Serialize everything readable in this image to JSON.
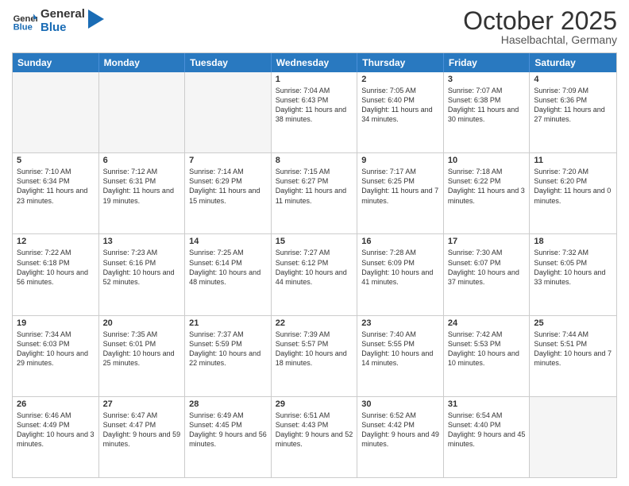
{
  "header": {
    "logo_line1": "General",
    "logo_line2": "Blue",
    "month": "October 2025",
    "location": "Haselbachtal, Germany"
  },
  "days_of_week": [
    "Sunday",
    "Monday",
    "Tuesday",
    "Wednesday",
    "Thursday",
    "Friday",
    "Saturday"
  ],
  "weeks": [
    [
      {
        "day": "",
        "empty": true
      },
      {
        "day": "",
        "empty": true
      },
      {
        "day": "",
        "empty": true
      },
      {
        "day": "1",
        "rise": "7:04 AM",
        "set": "6:43 PM",
        "daylight": "11 hours and 38 minutes."
      },
      {
        "day": "2",
        "rise": "7:05 AM",
        "set": "6:40 PM",
        "daylight": "11 hours and 34 minutes."
      },
      {
        "day": "3",
        "rise": "7:07 AM",
        "set": "6:38 PM",
        "daylight": "11 hours and 30 minutes."
      },
      {
        "day": "4",
        "rise": "7:09 AM",
        "set": "6:36 PM",
        "daylight": "11 hours and 27 minutes."
      }
    ],
    [
      {
        "day": "5",
        "rise": "7:10 AM",
        "set": "6:34 PM",
        "daylight": "11 hours and 23 minutes."
      },
      {
        "day": "6",
        "rise": "7:12 AM",
        "set": "6:31 PM",
        "daylight": "11 hours and 19 minutes."
      },
      {
        "day": "7",
        "rise": "7:14 AM",
        "set": "6:29 PM",
        "daylight": "11 hours and 15 minutes."
      },
      {
        "day": "8",
        "rise": "7:15 AM",
        "set": "6:27 PM",
        "daylight": "11 hours and 11 minutes."
      },
      {
        "day": "9",
        "rise": "7:17 AM",
        "set": "6:25 PM",
        "daylight": "11 hours and 7 minutes."
      },
      {
        "day": "10",
        "rise": "7:18 AM",
        "set": "6:22 PM",
        "daylight": "11 hours and 3 minutes."
      },
      {
        "day": "11",
        "rise": "7:20 AM",
        "set": "6:20 PM",
        "daylight": "11 hours and 0 minutes."
      }
    ],
    [
      {
        "day": "12",
        "rise": "7:22 AM",
        "set": "6:18 PM",
        "daylight": "10 hours and 56 minutes."
      },
      {
        "day": "13",
        "rise": "7:23 AM",
        "set": "6:16 PM",
        "daylight": "10 hours and 52 minutes."
      },
      {
        "day": "14",
        "rise": "7:25 AM",
        "set": "6:14 PM",
        "daylight": "10 hours and 48 minutes."
      },
      {
        "day": "15",
        "rise": "7:27 AM",
        "set": "6:12 PM",
        "daylight": "10 hours and 44 minutes."
      },
      {
        "day": "16",
        "rise": "7:28 AM",
        "set": "6:09 PM",
        "daylight": "10 hours and 41 minutes."
      },
      {
        "day": "17",
        "rise": "7:30 AM",
        "set": "6:07 PM",
        "daylight": "10 hours and 37 minutes."
      },
      {
        "day": "18",
        "rise": "7:32 AM",
        "set": "6:05 PM",
        "daylight": "10 hours and 33 minutes."
      }
    ],
    [
      {
        "day": "19",
        "rise": "7:34 AM",
        "set": "6:03 PM",
        "daylight": "10 hours and 29 minutes."
      },
      {
        "day": "20",
        "rise": "7:35 AM",
        "set": "6:01 PM",
        "daylight": "10 hours and 25 minutes."
      },
      {
        "day": "21",
        "rise": "7:37 AM",
        "set": "5:59 PM",
        "daylight": "10 hours and 22 minutes."
      },
      {
        "day": "22",
        "rise": "7:39 AM",
        "set": "5:57 PM",
        "daylight": "10 hours and 18 minutes."
      },
      {
        "day": "23",
        "rise": "7:40 AM",
        "set": "5:55 PM",
        "daylight": "10 hours and 14 minutes."
      },
      {
        "day": "24",
        "rise": "7:42 AM",
        "set": "5:53 PM",
        "daylight": "10 hours and 10 minutes."
      },
      {
        "day": "25",
        "rise": "7:44 AM",
        "set": "5:51 PM",
        "daylight": "10 hours and 7 minutes."
      }
    ],
    [
      {
        "day": "26",
        "rise": "6:46 AM",
        "set": "4:49 PM",
        "daylight": "10 hours and 3 minutes."
      },
      {
        "day": "27",
        "rise": "6:47 AM",
        "set": "4:47 PM",
        "daylight": "9 hours and 59 minutes."
      },
      {
        "day": "28",
        "rise": "6:49 AM",
        "set": "4:45 PM",
        "daylight": "9 hours and 56 minutes."
      },
      {
        "day": "29",
        "rise": "6:51 AM",
        "set": "4:43 PM",
        "daylight": "9 hours and 52 minutes."
      },
      {
        "day": "30",
        "rise": "6:52 AM",
        "set": "4:42 PM",
        "daylight": "9 hours and 49 minutes."
      },
      {
        "day": "31",
        "rise": "6:54 AM",
        "set": "4:40 PM",
        "daylight": "9 hours and 45 minutes."
      },
      {
        "day": "",
        "empty": true
      }
    ]
  ],
  "labels": {
    "sunrise": "Sunrise:",
    "sunset": "Sunset:",
    "daylight": "Daylight:"
  }
}
